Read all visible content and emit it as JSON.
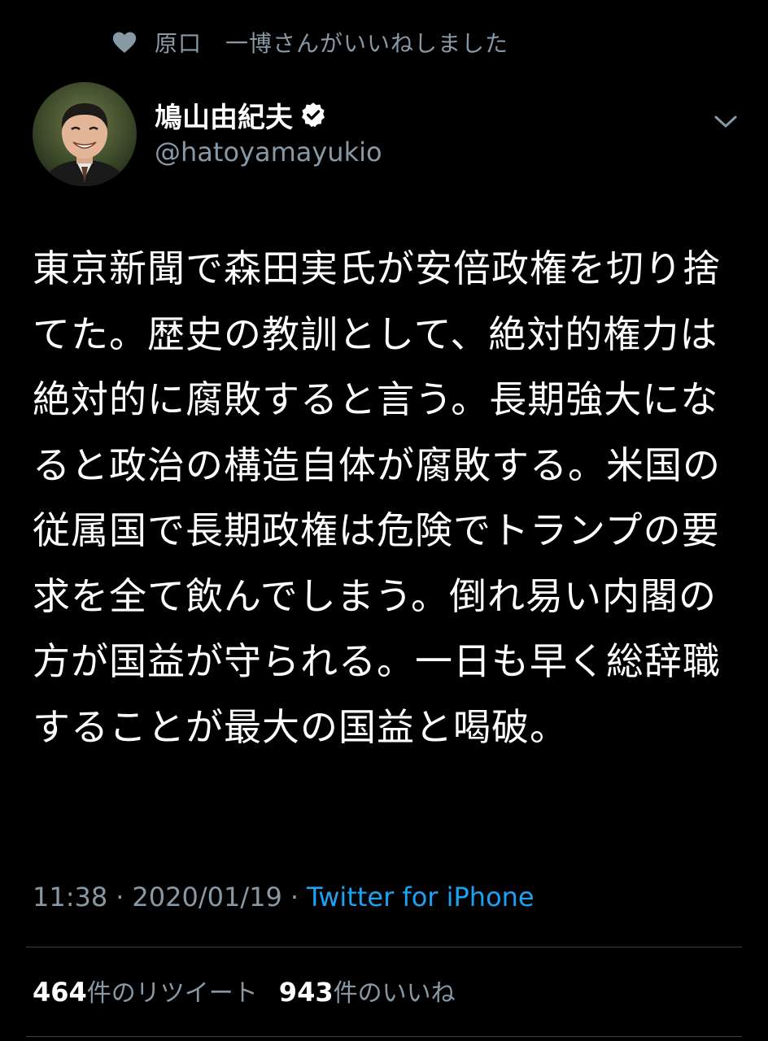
{
  "colors": {
    "background": "#000000",
    "primary_text": "#ffffff",
    "secondary_text": "#8899a6",
    "link": "#1da1f2",
    "divider": "#38444d"
  },
  "social_context": {
    "icon": "heart-icon",
    "text": "原口　一博さんがいいねしました"
  },
  "author": {
    "name": "鳩山由紀夫",
    "handle": "@hatoyamayukio",
    "verified_icon": "verified-badge-icon",
    "avatar": "avatar-photo"
  },
  "menu_icon": "chevron-down-icon",
  "tweet": {
    "text": "東京新聞で森田実氏が安倍政権を切り捨てた。歴史の教訓として、絶対的権力は絶対的に腐敗すると言う。長期強大になると政治の構造自体が腐敗する。米国の従属国で長期政権は危険でトランプの要求を全て飲んでしまう。倒れ易い内閣の方が国益が守られる。一日も早く総辞職することが最大の国益と喝破。"
  },
  "meta": {
    "time": "11:38",
    "separator": "·",
    "date": "2020/01/19",
    "source": "Twitter for iPhone"
  },
  "stats": {
    "retweets_count": "464",
    "retweets_label": "件のリツイート",
    "likes_count": "943",
    "likes_label": "件のいいね"
  }
}
